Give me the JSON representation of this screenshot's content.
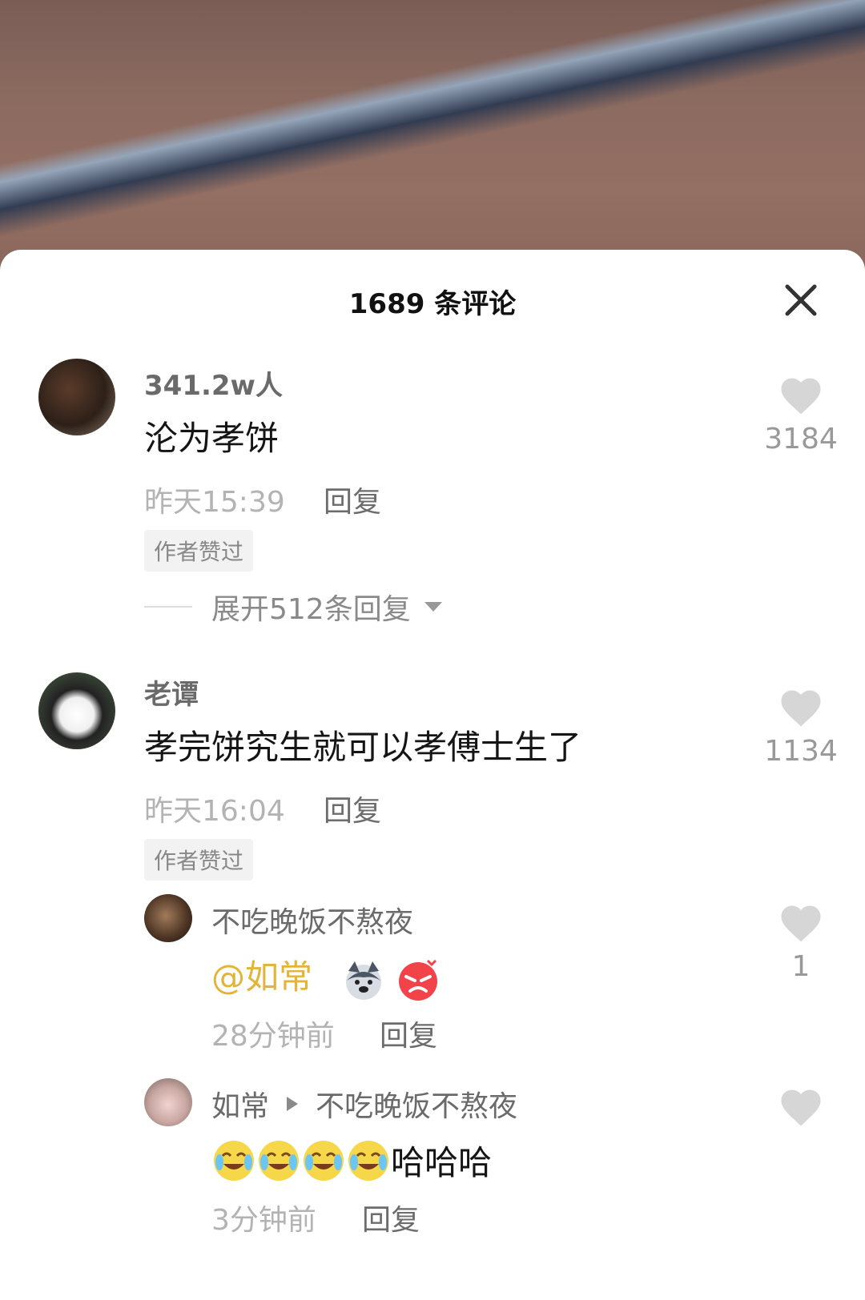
{
  "header": {
    "title": "1689 条评论"
  },
  "comments": [
    {
      "username": "341.2w人",
      "text": "沦为孝饼",
      "time": "昨天15:39",
      "reply_label": "回复",
      "badge": "作者赞过",
      "likes": "3184",
      "expand_label": "展开512条回复"
    },
    {
      "username": "老谭",
      "text": "孝完饼究生就可以孝傅士生了",
      "time": "昨天16:04",
      "reply_label": "回复",
      "badge": "作者赞过",
      "likes": "1134",
      "replies": [
        {
          "username": "不吃晚饭不熬夜",
          "mention": "@如常",
          "time": "28分钟前",
          "reply_label": "回复",
          "likes": "1"
        },
        {
          "username": "如常",
          "reply_to": "不吃晚饭不熬夜",
          "text": "哈哈哈",
          "time": "3分钟前",
          "reply_label": "回复",
          "likes": ""
        }
      ]
    }
  ],
  "colors": {
    "mention": "#e3b43a",
    "heart": "#d6d6d6"
  }
}
